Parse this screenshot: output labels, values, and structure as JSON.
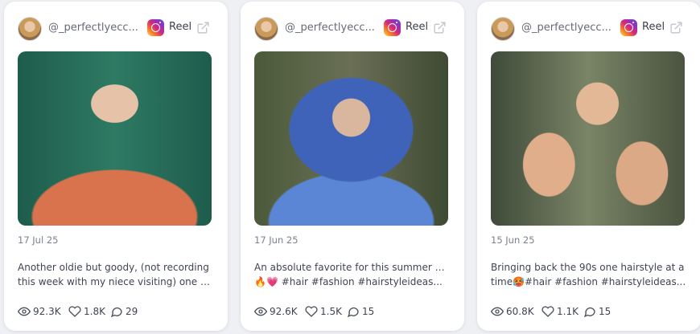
{
  "cards": [
    {
      "handle": "@_perfectlyecc...",
      "platform_label": "Reel",
      "date": "17 Jul 25",
      "caption_line1": "Another oldie but goody, (not recording",
      "caption_line2": "this week with my niece visiting) one of...",
      "views": "92.3K",
      "likes": "1.8K",
      "comments": "29"
    },
    {
      "handle": "@_perfectlyecc...",
      "platform_label": "Reel",
      "date": "17 Jun 25",
      "caption_line1": "An absolute favorite for this summer heat",
      "caption_line2": "🔥💗 #hair #fashion #hairstyleideas...",
      "views": "92.6K",
      "likes": "1.5K",
      "comments": "15"
    },
    {
      "handle": "@_perfectlyecc...",
      "platform_label": "Reel",
      "date": "15 Jun 25",
      "caption_line1": "Bringing back the 90s one hairstyle at a",
      "caption_line2": "time🥵#hair #fashion #hairstyleideas...",
      "views": "60.8K",
      "likes": "1.1K",
      "comments": "15"
    }
  ],
  "icons": {
    "platform": "instagram-icon",
    "external": "external-link-icon",
    "views": "eye-icon",
    "likes": "heart-icon",
    "comments": "comment-icon"
  }
}
